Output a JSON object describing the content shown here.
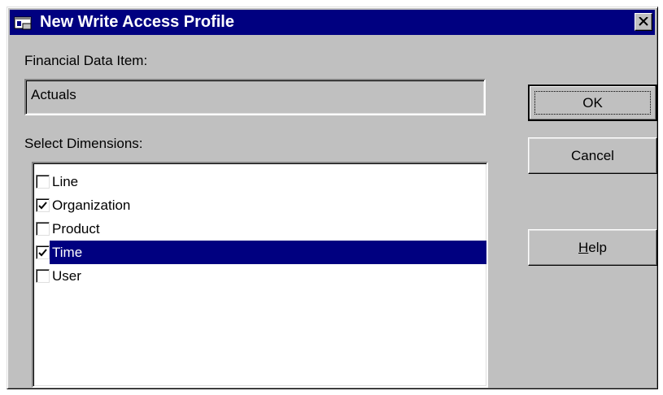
{
  "window": {
    "title": "New Write Access Profile",
    "close_glyph": "×"
  },
  "financial_data_item": {
    "label": "Financial Data Item:",
    "value": "Actuals"
  },
  "dimensions": {
    "label": "Select Dimensions:",
    "items": [
      {
        "label": "Line",
        "checked": false,
        "selected": false
      },
      {
        "label": "Organization",
        "checked": true,
        "selected": false
      },
      {
        "label": "Product",
        "checked": false,
        "selected": false
      },
      {
        "label": "Time",
        "checked": true,
        "selected": true
      },
      {
        "label": "User",
        "checked": false,
        "selected": false
      }
    ]
  },
  "buttons": {
    "ok": "OK",
    "cancel": "Cancel",
    "help_mnemonic": "H",
    "help_rest": "elp"
  },
  "colors": {
    "titlebar": "#000080",
    "face": "#c0c0c0",
    "selection": "#000080"
  },
  "icons": {
    "title": "app-window-icon",
    "close": "close-icon",
    "check": "checkmark-icon"
  }
}
